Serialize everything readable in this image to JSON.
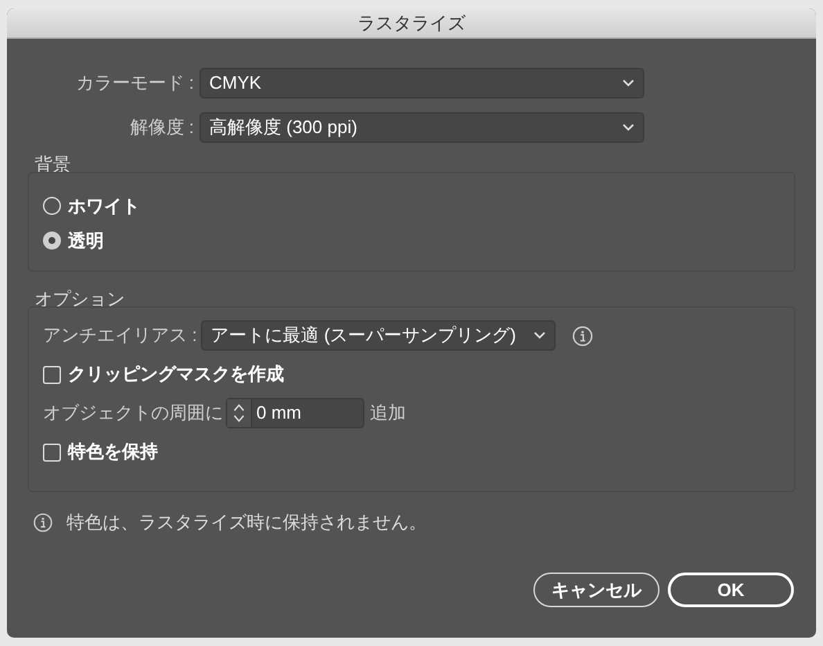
{
  "window": {
    "title": "ラスタライズ"
  },
  "fields": [
    {
      "label": "カラーモード :",
      "value": "CMYK"
    },
    {
      "label": "解像度 :",
      "value": "高解像度 (300 ppi)"
    }
  ],
  "background": {
    "title": "背景",
    "options": [
      {
        "label": "ホワイト",
        "selected": false
      },
      {
        "label": "透明",
        "selected": true
      }
    ]
  },
  "options": {
    "title": "オプション",
    "antialias": {
      "label": "アンチエイリアス :",
      "value": "アートに最適 (スーパーサンプリング)"
    },
    "clipping_mask": {
      "label": "クリッピングマスクを作成",
      "checked": false
    },
    "padding": {
      "label": "オブジェクトの周囲に",
      "value": "0 mm",
      "suffix": "追加"
    },
    "keep_spot": {
      "label": "特色を保持",
      "checked": false
    }
  },
  "info": "特色は、ラスタライズ時に保持されません。",
  "buttons": [
    {
      "label": "キャンセル",
      "default": false
    },
    {
      "label": "OK",
      "default": true
    }
  ]
}
